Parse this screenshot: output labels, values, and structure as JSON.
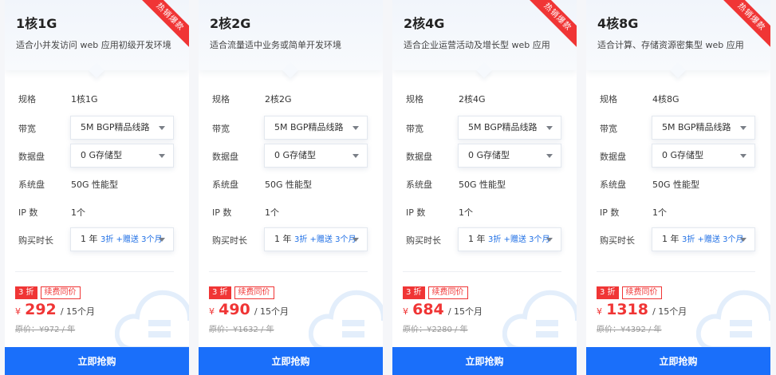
{
  "labels": {
    "spec": "规格",
    "bandwidth": "带宽",
    "data_disk": "数据盘",
    "system_disk": "系统盘",
    "ip_count": "IP 数",
    "duration": "购买时长"
  },
  "colors": {
    "accent_blue": "#1a6ffa",
    "discount_red": "#f03535",
    "background": "#f5f6f9"
  },
  "icons": {
    "select_caret": "chevron-down-icon",
    "watermark": "cloud-icon"
  },
  "products": [
    {
      "title": "1核1G",
      "desc": "适合小并发访问 web 应用初级开发环境",
      "ribbon": "热销爆款",
      "spec": "1核1G",
      "bandwidth": "5M BGP精品线路",
      "data_disk": "0 G存储型",
      "system_disk": "50G 性能型",
      "ip_count": "1个",
      "duration_main": "1 年",
      "duration_promo": "3折 +赠送 3个月",
      "discount_tag": "3 折",
      "renew_tag": "续费同价",
      "currency": "¥",
      "price": "292",
      "price_unit": "/ 15个月",
      "original_price": "原价：¥972 / 年",
      "buy_label": "立即抢购"
    },
    {
      "title": "2核2G",
      "desc": "适合流量适中业务或简单开发环境",
      "ribbon": "",
      "spec": "2核2G",
      "bandwidth": "5M BGP精品线路",
      "data_disk": "0 G存储型",
      "system_disk": "50G 性能型",
      "ip_count": "1个",
      "duration_main": "1 年",
      "duration_promo": "3折 +赠送 3个月",
      "discount_tag": "3 折",
      "renew_tag": "续费同价",
      "currency": "¥",
      "price": "490",
      "price_unit": "/ 15个月",
      "original_price": "原价：¥1632 / 年",
      "buy_label": "立即抢购"
    },
    {
      "title": "2核4G",
      "desc": "适合企业运营活动及增长型 web 应用",
      "ribbon": "热销爆款",
      "spec": "2核4G",
      "bandwidth": "5M BGP精品线路",
      "data_disk": "0 G存储型",
      "system_disk": "50G 性能型",
      "ip_count": "1个",
      "duration_main": "1 年",
      "duration_promo": "3折 +赠送 3个月",
      "discount_tag": "3 折",
      "renew_tag": "续费同价",
      "currency": "¥",
      "price": "684",
      "price_unit": "/ 15个月",
      "original_price": "原价：¥2280 / 年",
      "buy_label": "立即抢购"
    },
    {
      "title": "4核8G",
      "desc": "适合计算、存储资源密集型 web 应用",
      "ribbon": "热销爆款",
      "spec": "4核8G",
      "bandwidth": "5M BGP精品线路",
      "data_disk": "0 G存储型",
      "system_disk": "50G 性能型",
      "ip_count": "1个",
      "duration_main": "1 年",
      "duration_promo": "3折 +赠送 3个月",
      "discount_tag": "3 折",
      "renew_tag": "续费同价",
      "currency": "¥",
      "price": "1318",
      "price_unit": "/ 15个月",
      "original_price": "原价：¥4392 / 年",
      "buy_label": "立即抢购"
    }
  ]
}
